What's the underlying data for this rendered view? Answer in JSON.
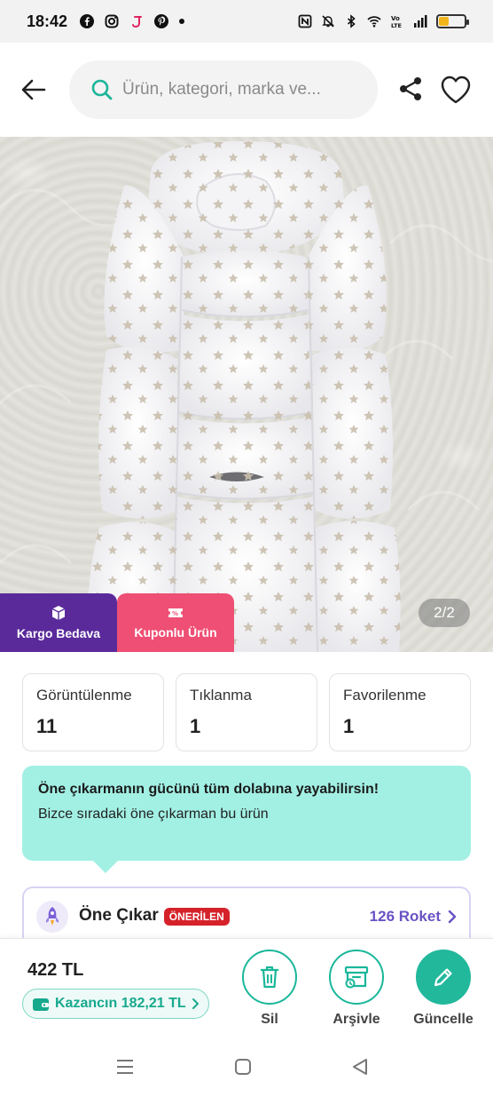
{
  "status_bar": {
    "time": "18:42"
  },
  "header": {
    "search_placeholder": "Ürün, kategori, marka ve..."
  },
  "photo": {
    "counter": "2/2"
  },
  "badges": {
    "cargo": "Kargo Bedava",
    "coupon": "Kuponlu Ürün"
  },
  "stats": [
    {
      "label": "Görüntülenme",
      "value": "11"
    },
    {
      "label": "Tıklanma",
      "value": "1"
    },
    {
      "label": "Favorilenme",
      "value": "1"
    }
  ],
  "promo": {
    "title": "Öne çıkarmanın gücünü tüm dolabına yayabilirsin!",
    "text": "Bizce sıradaki öne çıkarman bu ürün"
  },
  "boost": {
    "title": "Öne Çıkar",
    "badge": "ÖNERİLEN",
    "rockets": "126 Roket"
  },
  "bottom": {
    "price": "422 TL",
    "earnings": "Kazancın 182,21 TL",
    "delete_label": "Sil",
    "archive_label": "Arşivle",
    "update_label": "Güncelle"
  },
  "colors": {
    "teal": "#22b89c",
    "purple": "#5a2a9b",
    "pink": "#ef4f74",
    "promo_bg": "#a2f0e4",
    "rocket_text": "#6a52c4",
    "recommended": "#d5222a"
  }
}
